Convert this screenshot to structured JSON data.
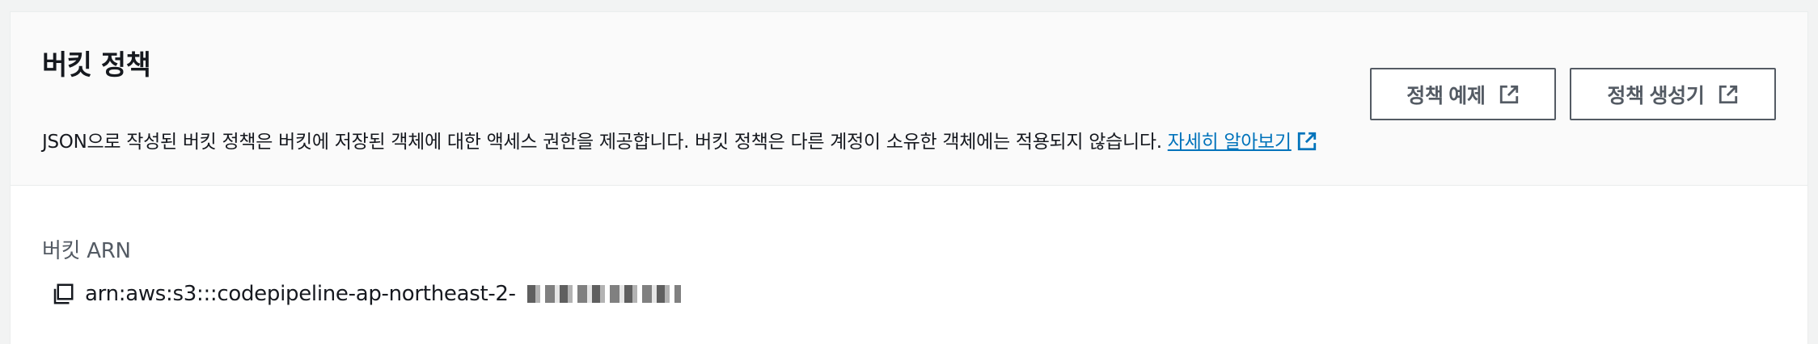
{
  "header": {
    "title": "버킷 정책",
    "description": "JSON으로 작성된 버킷 정책은 버킷에 저장된 객체에 대한 액세스 권한을 제공합니다. 버킷 정책은 다른 계정이 소유한 객체에는 적용되지 않습니다.",
    "learn_more": "자세히 알아보기",
    "buttons": {
      "policy_examples": "정책 예제",
      "policy_generator": "정책 생성기"
    }
  },
  "arn": {
    "label": "버킷 ARN",
    "value": "arn:aws:s3:::codepipeline-ap-northeast-2-"
  },
  "icons": [
    "external-link-icon",
    "copy-icon"
  ],
  "colors": {
    "link": "#0073bb",
    "button_border": "#545b64",
    "header_bg": "#fafafa"
  }
}
